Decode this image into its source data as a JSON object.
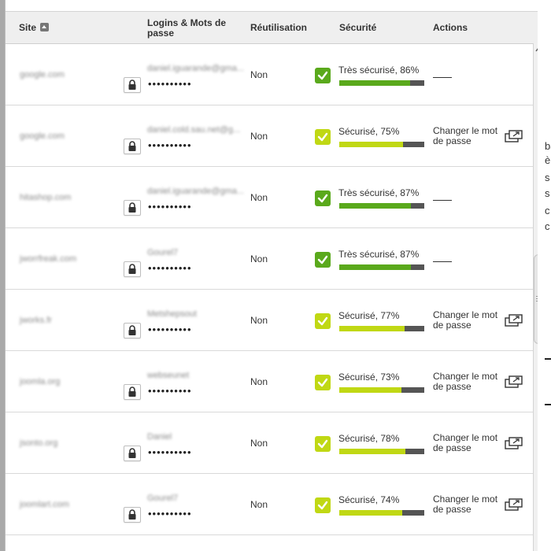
{
  "colors": {
    "strong": "#5aa91c",
    "good": "#c0d814",
    "bar_empty": "#555555"
  },
  "background_text": [
    "ba",
    "è",
    "s",
    "s",
    "c",
    "c"
  ],
  "header": {
    "site": "Site",
    "logins_line1": "Logins & Mots de",
    "logins_line2": "passe",
    "reuse": "Réutilisation",
    "security": "Sécurité",
    "actions": "Actions"
  },
  "rows": [
    {
      "site": "google.com",
      "login": "daniel.iguarande@gma...",
      "password": "••••••••••",
      "reuse": "Non",
      "security": "Très sécurisé, 86%",
      "level": "strong",
      "score": 86,
      "action": ""
    },
    {
      "site": "google.com",
      "login": "daniel.cold.sau.net@g...",
      "password": "••••••••••",
      "reuse": "Non",
      "security": "Sécurisé, 75%",
      "level": "good",
      "score": 75,
      "action": "Changer le mot de passe"
    },
    {
      "site": "hitashop.com",
      "login": "daniel.iguarande@gma...",
      "password": "••••••••••",
      "reuse": "Non",
      "security": "Très sécurisé, 87%",
      "level": "strong",
      "score": 87,
      "action": ""
    },
    {
      "site": "jworrfreak.com",
      "login": "Gourel7",
      "password": "••••••••••",
      "reuse": "Non",
      "security": "Très sécurisé, 87%",
      "level": "strong",
      "score": 87,
      "action": ""
    },
    {
      "site": "jworks.fr",
      "login": "Metshepsout",
      "password": "••••••••••",
      "reuse": "Non",
      "security": "Sécurisé, 77%",
      "level": "good",
      "score": 77,
      "action": "Changer le mot de passe"
    },
    {
      "site": "joomla.org",
      "login": "webseunet",
      "password": "••••••••••",
      "reuse": "Non",
      "security": "Sécurisé, 73%",
      "level": "good",
      "score": 73,
      "action": "Changer le mot de passe"
    },
    {
      "site": "jsonto.org",
      "login": "Daniel",
      "password": "••••••••••",
      "reuse": "Non",
      "security": "Sécurisé, 78%",
      "level": "good",
      "score": 78,
      "action": "Changer le mot de passe"
    },
    {
      "site": "joomlart.com",
      "login": "Gourel7",
      "password": "••••••••••",
      "reuse": "Non",
      "security": "Sécurisé, 74%",
      "level": "good",
      "score": 74,
      "action": "Changer le mot de passe"
    }
  ]
}
